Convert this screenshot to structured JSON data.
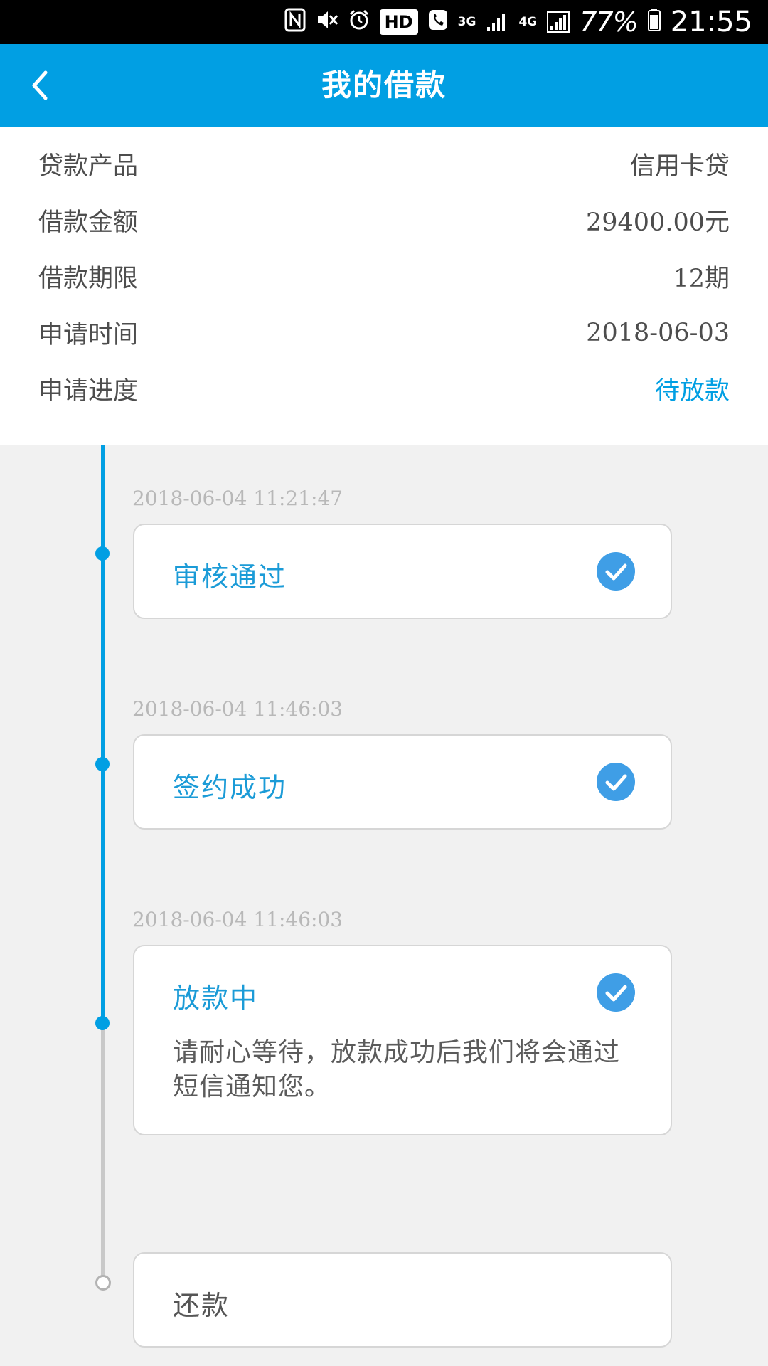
{
  "status_bar": {
    "network": "3G",
    "network2": "4G",
    "hd_label": "HD",
    "battery": "77%",
    "time": "21:55"
  },
  "header": {
    "title": "我的借款"
  },
  "loan": {
    "rows": [
      {
        "label": "贷款产品",
        "value": "信用卡贷"
      },
      {
        "label": "借款金额",
        "value": "29400.00元"
      },
      {
        "label": "借款期限",
        "value": "12期"
      },
      {
        "label": "申请时间",
        "value": "2018-06-03"
      },
      {
        "label": "申请进度",
        "value": "待放款"
      }
    ]
  },
  "timeline": {
    "steps": [
      {
        "time": "2018-06-04 11:21:47",
        "title": "审核通过",
        "done": true
      },
      {
        "time": "2018-06-04 11:46:03",
        "title": "签约成功",
        "done": true
      },
      {
        "time": "2018-06-04 11:46:03",
        "title": "放款中",
        "done": true,
        "description": "请耐心等待，放款成功后我们将会通过短信通知您。"
      },
      {
        "title": "还款",
        "done": false
      }
    ]
  },
  "colors": {
    "brand": "#019fe3",
    "check_circle": "#3f9ee6",
    "pending_line": "#c9c9c9"
  }
}
